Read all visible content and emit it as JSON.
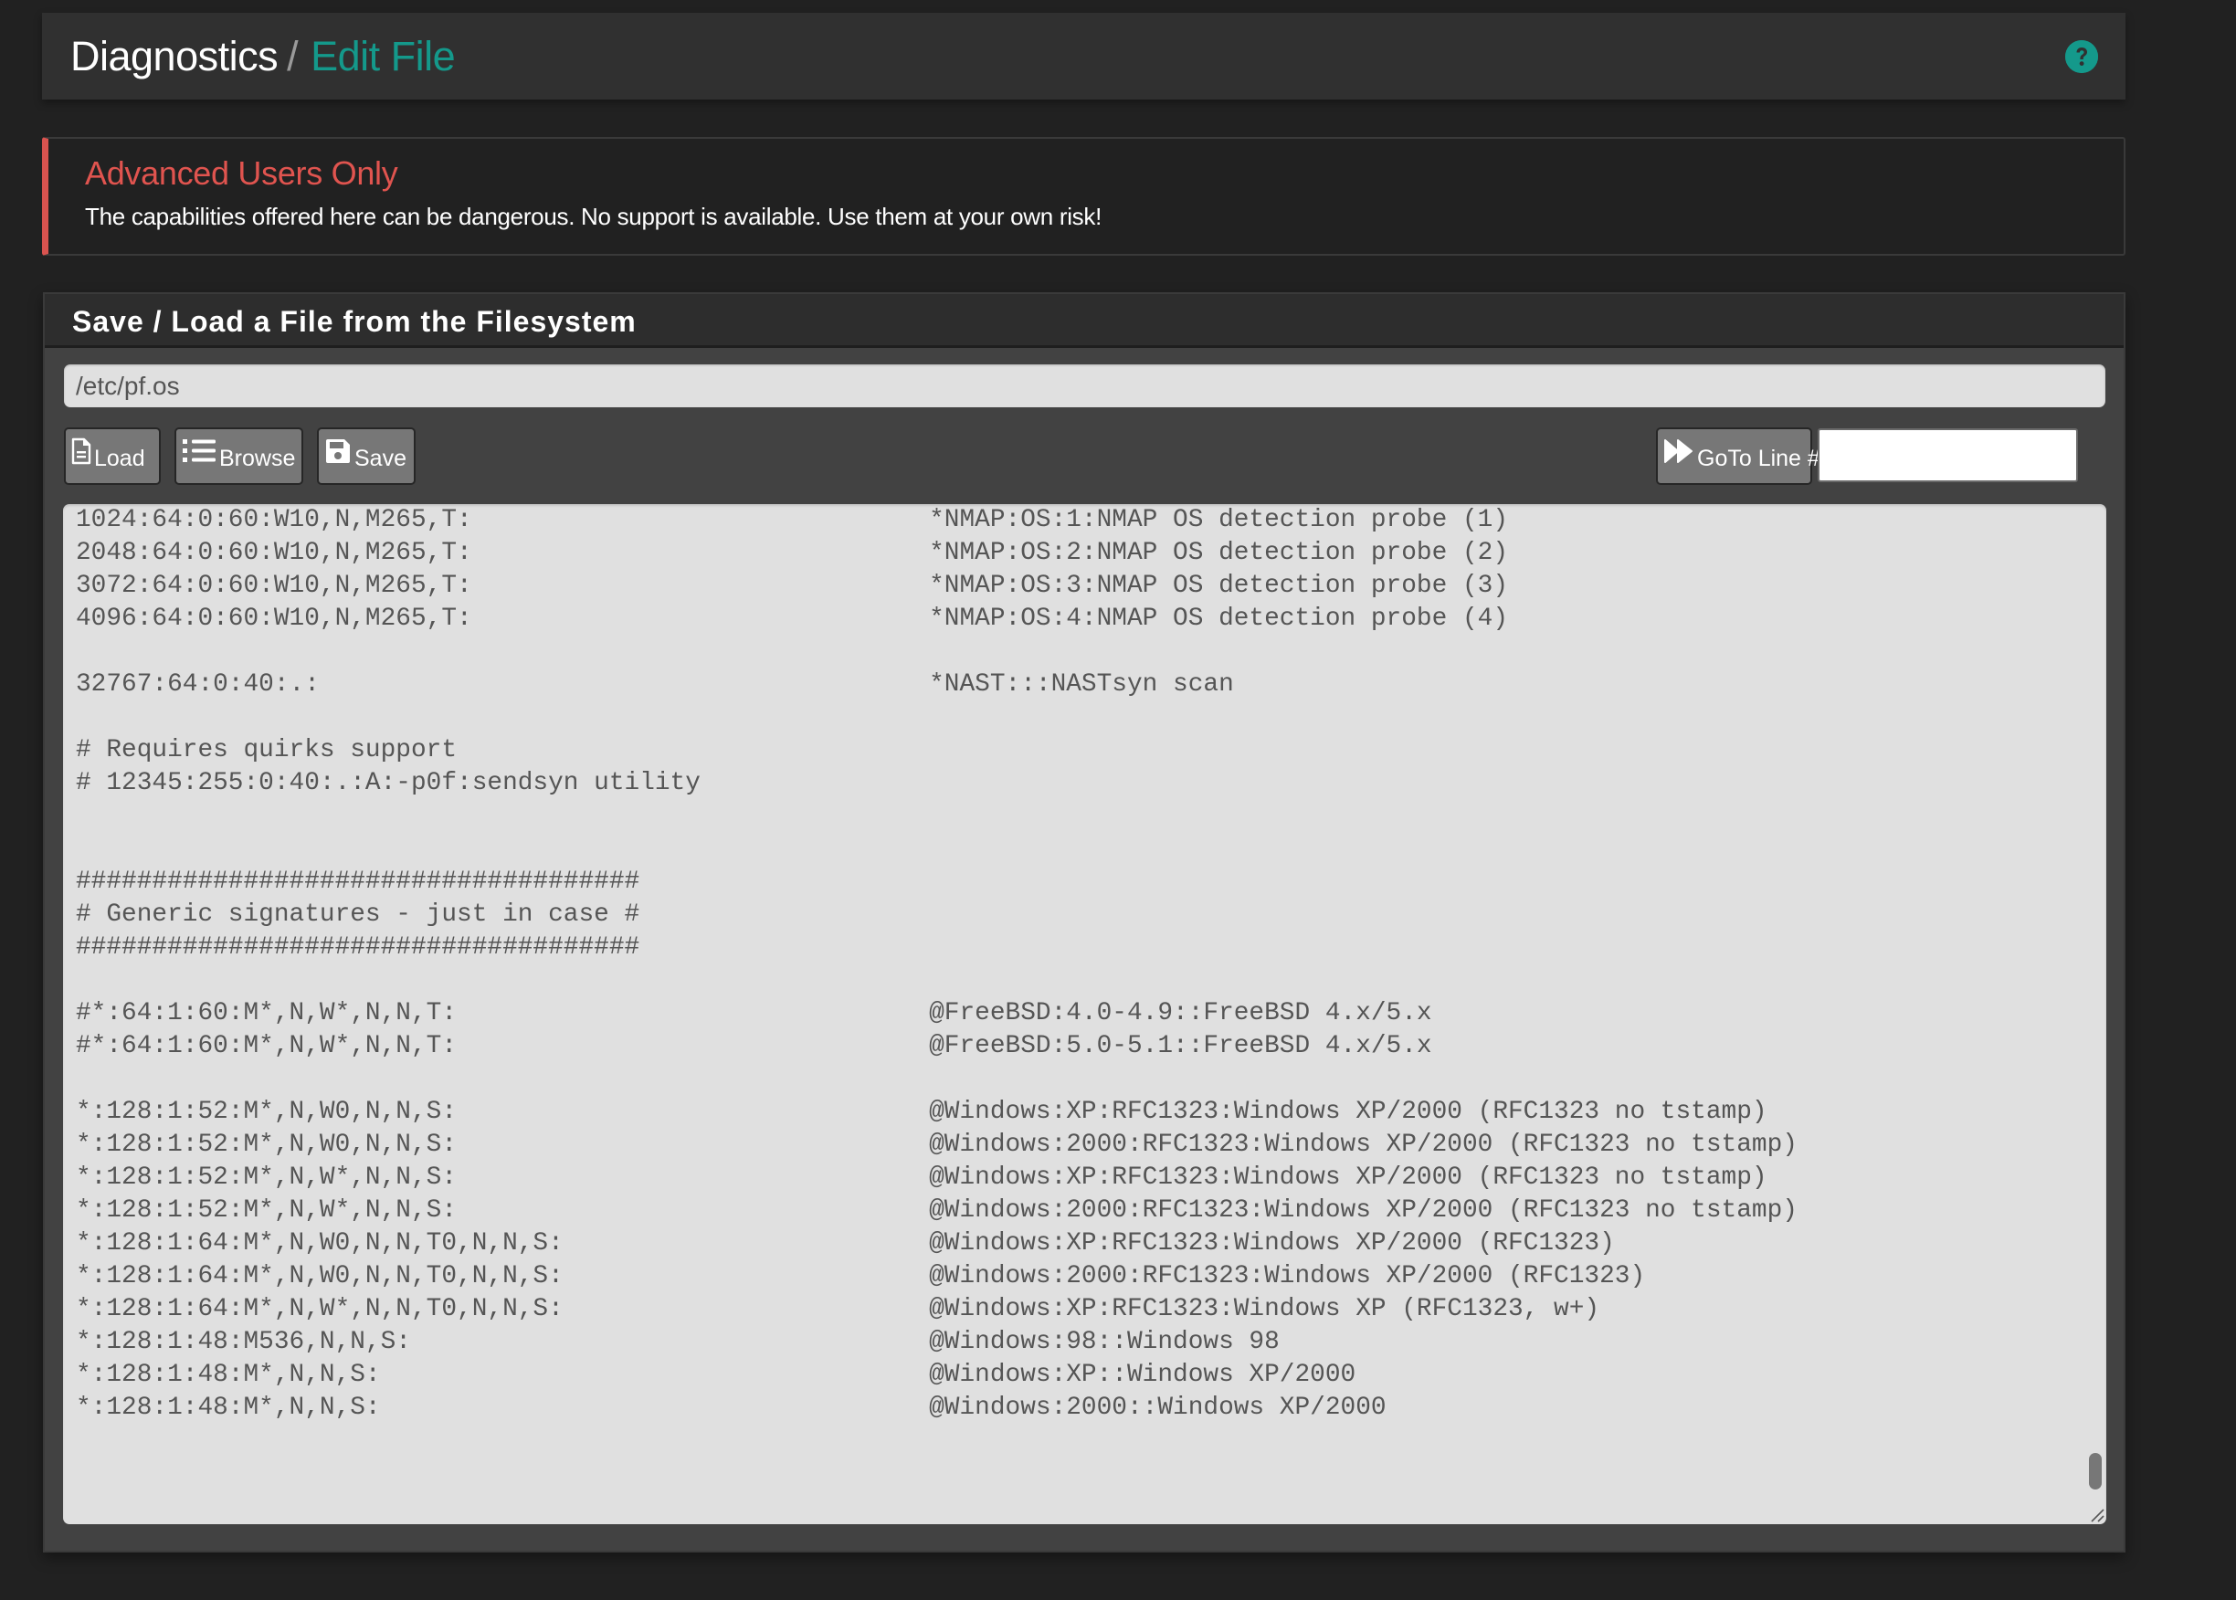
{
  "header": {
    "breadcrumb_root": "Diagnostics",
    "breadcrumb_separator": "/",
    "breadcrumb_current": "Edit File",
    "help_icon": "question-circle-icon",
    "accent_color": "#14998b"
  },
  "alert": {
    "title": "Advanced Users Only",
    "body": "The capabilities offered here can be dangerous. No support is available. Use them at your own risk!",
    "accent_color": "#d9534f"
  },
  "panel": {
    "title": "Save / Load a File from the Filesystem",
    "file_path_value": "/etc/pf.os",
    "buttons": {
      "load": {
        "label": "Load",
        "icon": "file-icon"
      },
      "browse": {
        "label": "Browse",
        "icon": "list-icon"
      },
      "save": {
        "label": "Save",
        "icon": "floppy-disk-icon"
      },
      "goto": {
        "label": "GoTo Line #",
        "icon": "fast-forward-icon"
      }
    },
    "goto_line_value": "",
    "editor_lines": [
      "1024:64:0:60:W10,N,M265,T:\t\t\t\t*NMAP:OS:1:NMAP OS detection probe (1)",
      "2048:64:0:60:W10,N,M265,T:\t\t\t\t*NMAP:OS:2:NMAP OS detection probe (2)",
      "3072:64:0:60:W10,N,M265,T:\t\t\t\t*NMAP:OS:3:NMAP OS detection probe (3)",
      "4096:64:0:60:W10,N,M265,T:\t\t\t\t*NMAP:OS:4:NMAP OS detection probe (4)",
      "",
      "32767:64:0:40:.:\t\t\t\t\t*NAST:::NASTsyn scan",
      "",
      "# Requires quirks support",
      "# 12345:255:0:40:.:A:-p0f:sendsyn utility",
      "",
      "",
      "#####################################",
      "# Generic signatures - just in case #",
      "#####################################",
      "",
      "#*:64:1:60:M*,N,W*,N,N,T:\t\t\t\t@FreeBSD:4.0-4.9::FreeBSD 4.x/5.x",
      "#*:64:1:60:M*,N,W*,N,N,T:\t\t\t\t@FreeBSD:5.0-5.1::FreeBSD 4.x/5.x",
      "",
      "*:128:1:52:M*,N,W0,N,N,S:\t\t\t\t@Windows:XP:RFC1323:Windows XP/2000 (RFC1323 no tstamp)",
      "*:128:1:52:M*,N,W0,N,N,S:\t\t\t\t@Windows:2000:RFC1323:Windows XP/2000 (RFC1323 no tstamp)",
      "*:128:1:52:M*,N,W*,N,N,S:\t\t\t\t@Windows:XP:RFC1323:Windows XP/2000 (RFC1323 no tstamp)",
      "*:128:1:52:M*,N,W*,N,N,S:\t\t\t\t@Windows:2000:RFC1323:Windows XP/2000 (RFC1323 no tstamp)",
      "*:128:1:64:M*,N,W0,N,N,T0,N,N,S:\t\t\t@Windows:XP:RFC1323:Windows XP/2000 (RFC1323)",
      "*:128:1:64:M*,N,W0,N,N,T0,N,N,S:\t\t\t@Windows:2000:RFC1323:Windows XP/2000 (RFC1323)",
      "*:128:1:64:M*,N,W*,N,N,T0,N,N,S:\t\t\t@Windows:XP:RFC1323:Windows XP (RFC1323, w+)",
      "*:128:1:48:M536,N,N,S:\t\t\t\t\t@Windows:98::Windows 98",
      "*:128:1:48:M*,N,N,S:\t\t\t\t\t@Windows:XP::Windows XP/2000",
      "*:128:1:48:M*,N,N,S:\t\t\t\t\t@Windows:2000::Windows XP/2000"
    ]
  }
}
